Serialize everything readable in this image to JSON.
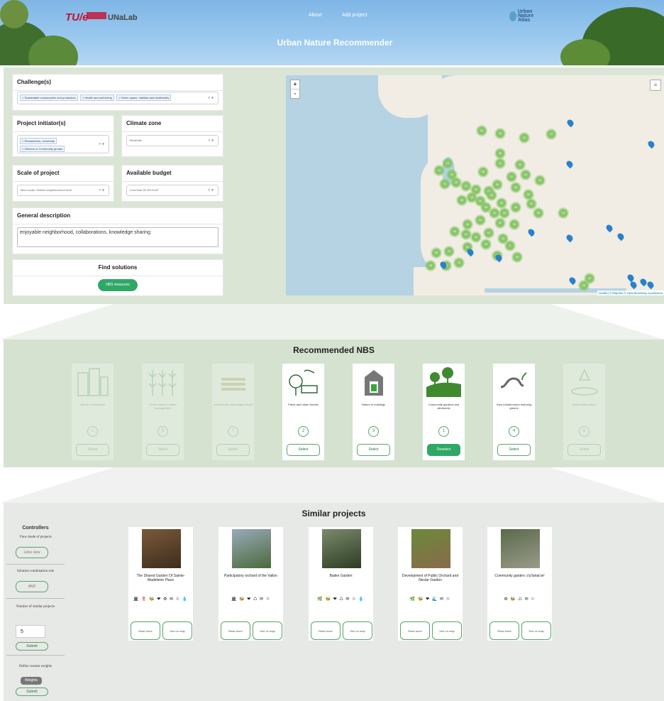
{
  "header": {
    "title": "Urban Nature Recommender",
    "nav": [
      "About",
      "Add project"
    ],
    "logo_tue": "TU/e",
    "logo_unalab": "UNaLab",
    "logo_atlas": [
      "Urban",
      "Nature",
      "Atlas"
    ]
  },
  "filters": {
    "challenges": {
      "label": "Challenge(s)",
      "tags": [
        "Sustainable consumption and production",
        "Health and well-being",
        "Green space, habitats and biodiversity"
      ]
    },
    "initiator": {
      "label": "Project initiator(s)",
      "tags": [
        "Researchers, University",
        "Citizens or Community groups"
      ]
    },
    "climate": {
      "label": "Climate zone",
      "value": "Moderate"
    },
    "scale": {
      "label": "Scale of project",
      "value": "Micro-scale: District neighbourhood level"
    },
    "budget": {
      "label": "Available budget",
      "value": "Less than 50 000 EUR"
    },
    "description": {
      "label": "General description",
      "value": "enjoyable neighborhood, collaborations, knowledge sharing"
    },
    "find": {
      "label": "Find solutions",
      "button": "NBS measures"
    }
  },
  "map": {
    "zoom_in": "+",
    "zoom_out": "-",
    "attribution": "Leaflet | © Map tiler © OpenStreetMap contributors",
    "cluster_counts": [
      "10",
      "18",
      "13",
      "17",
      "20",
      "19",
      "11",
      "23",
      "14",
      "10",
      "18",
      "27",
      "14",
      "13",
      "11",
      "15",
      "11",
      "10",
      "20",
      "33",
      "24",
      "29",
      "18",
      "13",
      "10",
      "15",
      "12",
      "19",
      "11",
      "26",
      "16",
      "31",
      "15",
      "22",
      "10",
      "14",
      "16",
      "24",
      "11",
      "16",
      "14",
      "13",
      "9",
      "16",
      "27",
      "19",
      "21",
      "28",
      "15",
      "12",
      "13",
      "11"
    ]
  },
  "recommended": {
    "title": "Recommended NBS",
    "cards": [
      {
        "label": "Nature on buildings",
        "rank": "1",
        "button": "Select",
        "dim": true,
        "icon": "buildings-icon"
      },
      {
        "label": "Green areas for water management",
        "rank": "5",
        "button": "Select",
        "dim": true,
        "icon": "plants-icon"
      },
      {
        "label": "Intentionally unmanaged areas",
        "rank": "7",
        "button": "Select",
        "dim": true,
        "icon": "field-icon"
      },
      {
        "label": "Parks and urban forests",
        "rank": "2",
        "button": "Select",
        "dim": false,
        "icon": "park-icon"
      },
      {
        "label": "Nature in buildings",
        "rank": "3",
        "button": "Select",
        "dim": false,
        "icon": "house-icon"
      },
      {
        "label": "Community gardens and allotments",
        "rank": "1",
        "button": "Deselect",
        "dim": false,
        "selected": true,
        "icon": "garden-icon"
      },
      {
        "label": "Grey infrastructure featuring greens",
        "rank": "4",
        "button": "Select",
        "dim": false,
        "icon": "pipe-plant-icon"
      },
      {
        "label": "Blue infrastructure",
        "rank": "6",
        "button": "Select",
        "dim": true,
        "icon": "pond-icon"
      }
    ]
  },
  "similar": {
    "title": "Similar projects",
    "controllers": {
      "title": "Controllers",
      "view_mode_label": "View mode of projects",
      "view_mode_button": "Links view",
      "combination_label": "Solution combination rule",
      "combination_button": "AND",
      "number_label": "Number of similar projects",
      "number_value": "5",
      "submit": "Submit",
      "weights_label": "Define custom weights",
      "weights_button": "Weights",
      "weights_submit": "Submit"
    },
    "projects": [
      {
        "title": "The Shared Garden Of Sainte-Madeleine Place",
        "icons": "🏛 🌷 🐝 ❤ ♻ ✉ ♲ 💧",
        "read": "Read more",
        "map": "See on map"
      },
      {
        "title": "Participatory orchard of the Vallon",
        "icons": "🏛 🐝 ❤ ♺ ✉ ♲",
        "read": "Read more",
        "map": "See on map"
      },
      {
        "title": "Bailen Garden",
        "icons": "🌿 🐝 ❤ ♺ ✉ ♲ 💧",
        "read": "Read more",
        "map": "See on map"
      },
      {
        "title": "Development of Public Orchard and Nectar Garden",
        "icons": "🌿 🐝 ❤ 🌊 ✉ ♲",
        "read": "Read more",
        "map": "See on map"
      },
      {
        "title": "Community garden: o'p'lanat.te!",
        "icons": "⚙ 🐝 ♺ ✉ ♲",
        "read": "Read more",
        "map": "See on map"
      }
    ]
  }
}
